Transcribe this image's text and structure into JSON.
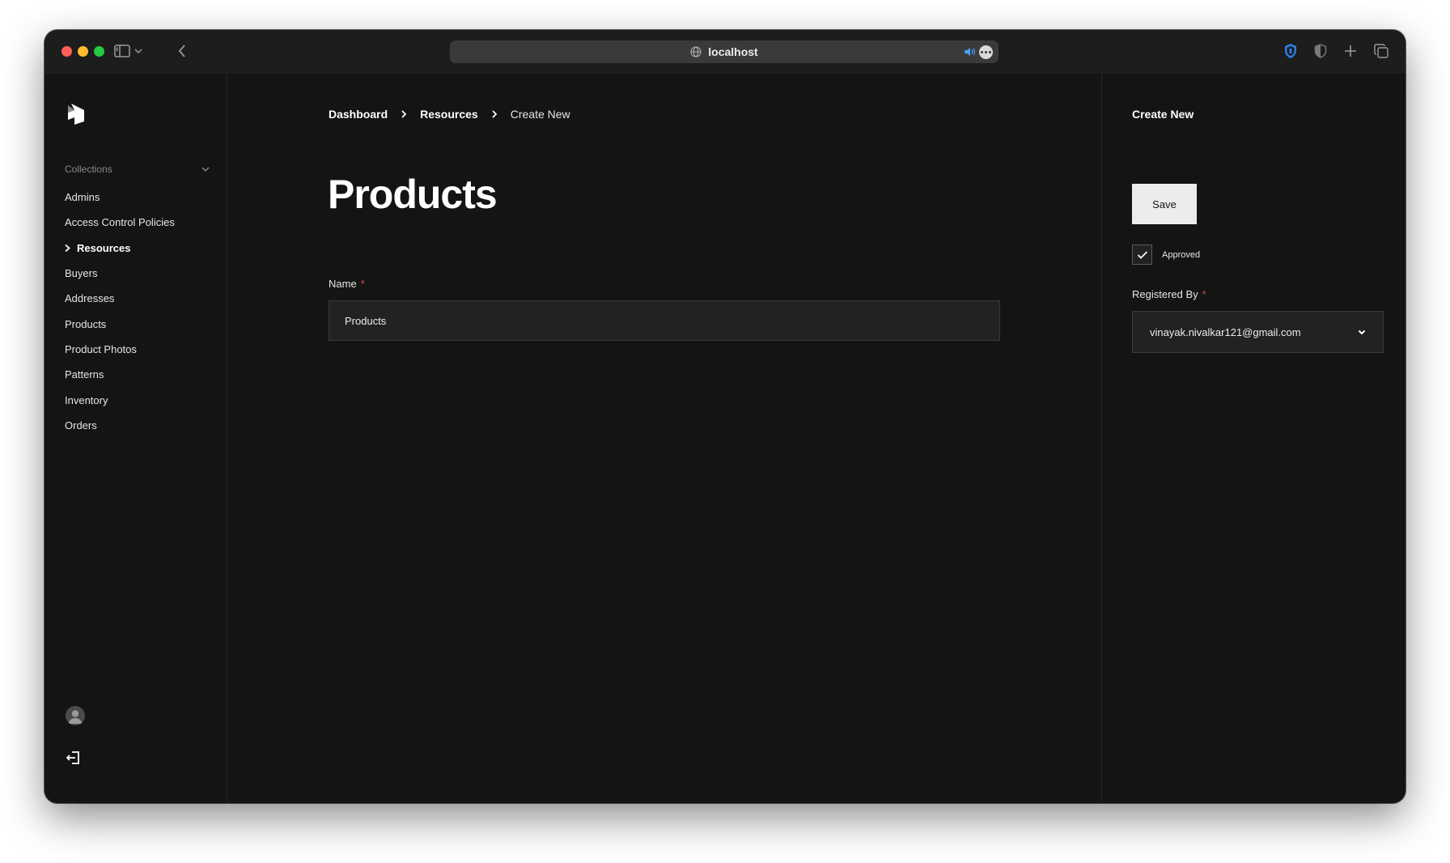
{
  "browser": {
    "url": "localhost",
    "icons": {
      "sidebar_toggle": "sidebar-icon",
      "tab_menu": "chevron-down-icon",
      "back": "back-arrow-icon",
      "globe": "globe-icon",
      "audio": "speaker-icon",
      "page_menu": "more-icon",
      "password_manager": "shield-icon",
      "privacy": "half-shield-icon",
      "new_tab": "plus-icon",
      "tab_overview": "tabs-icon"
    },
    "accent_color": "#4a9cff"
  },
  "sidebar": {
    "section_label": "Collections",
    "items": [
      {
        "label": "Admins",
        "active": false
      },
      {
        "label": "Access Control Policies",
        "active": false
      },
      {
        "label": "Resources",
        "active": true
      },
      {
        "label": "Buyers",
        "active": false
      },
      {
        "label": "Addresses",
        "active": false
      },
      {
        "label": "Products",
        "active": false
      },
      {
        "label": "Product Photos",
        "active": false
      },
      {
        "label": "Patterns",
        "active": false
      },
      {
        "label": "Inventory",
        "active": false
      },
      {
        "label": "Orders",
        "active": false
      }
    ]
  },
  "breadcrumb": {
    "items": [
      "Dashboard",
      "Resources",
      "Create New"
    ]
  },
  "main": {
    "title": "Products",
    "name_field": {
      "label": "Name",
      "required_mark": "*",
      "value": "Products"
    }
  },
  "right_panel": {
    "title": "Create New",
    "save_label": "Save",
    "approved": {
      "label": "Approved",
      "checked": true
    },
    "registered_by": {
      "label": "Registered By",
      "required_mark": "*",
      "value": "vinayak.nivalkar121@gmail.com"
    }
  },
  "colors": {
    "background": "#141414",
    "required": "#e04848",
    "button_bg": "#ececec"
  }
}
